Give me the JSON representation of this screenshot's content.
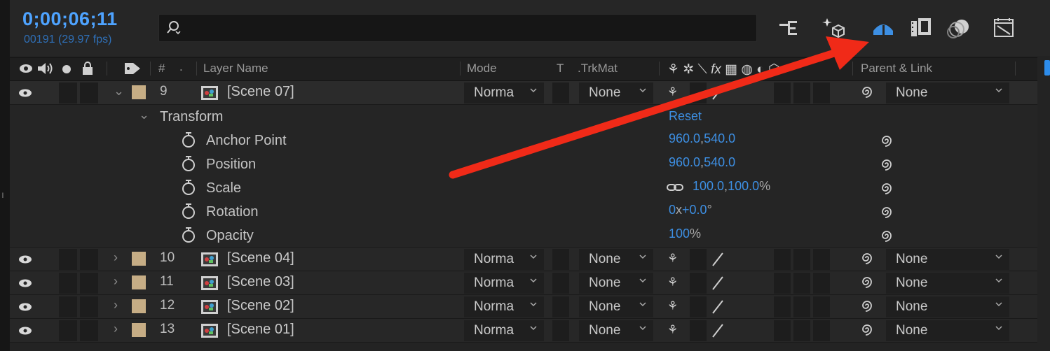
{
  "header": {
    "timecode": "0;00;06;11",
    "frame_info": "00191 (29.97 fps)",
    "search": {
      "value": "",
      "placeholder": ""
    }
  },
  "columns": {
    "hash": "#",
    "layer_name": "Layer Name",
    "mode": "Mode",
    "t": "T",
    "trkmat": ".TrkMat",
    "parent_link": "Parent & Link"
  },
  "layers": [
    {
      "num": "9",
      "name": "[Scene 07]",
      "mode": "Norma",
      "trkmat": "None",
      "parent": "None"
    },
    {
      "num": "10",
      "name": "[Scene 04]",
      "mode": "Norma",
      "trkmat": "None",
      "parent": "None"
    },
    {
      "num": "11",
      "name": "[Scene 03]",
      "mode": "Norma",
      "trkmat": "None",
      "parent": "None"
    },
    {
      "num": "12",
      "name": "[Scene 02]",
      "mode": "Norma",
      "trkmat": "None",
      "parent": "None"
    },
    {
      "num": "13",
      "name": "[Scene 01]",
      "mode": "Norma",
      "trkmat": "None",
      "parent": "None"
    }
  ],
  "transform": {
    "label": "Transform",
    "reset": "Reset",
    "properties": [
      {
        "name": "Anchor Point",
        "v1": "960.0",
        "sep": ",",
        "v2": "540.0",
        "unit": ""
      },
      {
        "name": "Position",
        "v1": "960.0",
        "sep": ",",
        "v2": "540.0",
        "unit": ""
      },
      {
        "name": "Scale",
        "v1": "100.0",
        "sep": ",",
        "v2": "100.0",
        "unit": "%"
      },
      {
        "name": "Rotation",
        "v1": "0",
        "sep": "x",
        "v2": "+0.0",
        "unit": "°"
      },
      {
        "name": "Opacity",
        "v1": "100",
        "sep": "",
        "v2": "",
        "unit": "%"
      }
    ]
  },
  "colors": {
    "accent": "#4ea3ff",
    "value_blue": "#3d8fe3",
    "label_swatch": "#c6ad85",
    "annotation_arrow": "#f02a18"
  }
}
